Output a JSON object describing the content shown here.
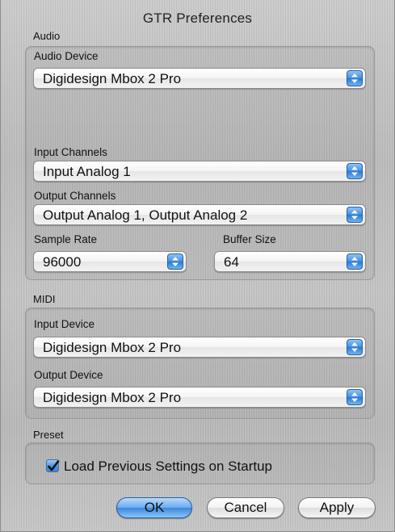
{
  "window": {
    "title": "GTR Preferences"
  },
  "audio": {
    "section_label": "Audio",
    "device_label": "Audio Device",
    "device_value": "Digidesign Mbox 2 Pro",
    "input_label": "Input Channels",
    "input_value": "Input Analog 1",
    "output_label": "Output Channels",
    "output_value": "Output Analog 1, Output Analog 2",
    "sample_rate_label": "Sample Rate",
    "sample_rate_value": "96000",
    "buffer_size_label": "Buffer Size",
    "buffer_size_value": "64"
  },
  "midi": {
    "section_label": "MIDI",
    "input_label": "Input Device",
    "input_value": "Digidesign Mbox 2 Pro",
    "output_label": "Output Device",
    "output_value": "Digidesign Mbox 2 Pro"
  },
  "preset": {
    "section_label": "Preset",
    "load_previous_label": "Load Previous Settings on Startup",
    "load_previous_checked": true
  },
  "buttons": {
    "ok": "OK",
    "cancel": "Cancel",
    "apply": "Apply"
  },
  "colors": {
    "accent": "#3b87dc",
    "window_bg": "#c0c0c0"
  }
}
